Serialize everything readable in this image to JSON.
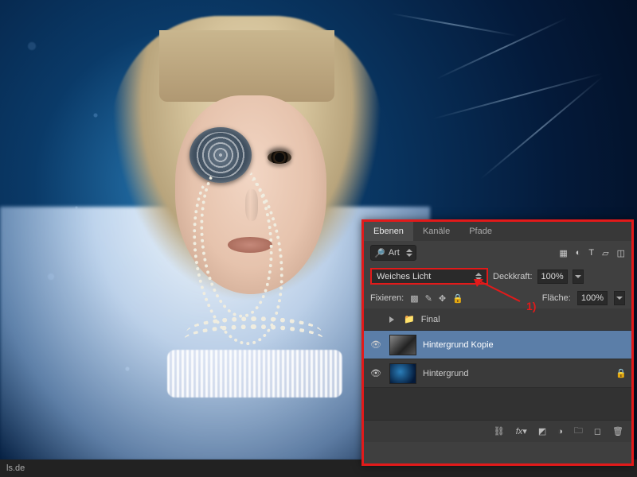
{
  "footer_text": "ls.de",
  "panel": {
    "tabs": [
      "Ebenen",
      "Kanäle",
      "Pfade"
    ],
    "active_tab": 0,
    "filter_label": "Art",
    "blend_mode": "Weiches Licht",
    "opacity_label": "Deckkraft:",
    "opacity_value": "100%",
    "lock_label": "Fixieren:",
    "fill_label": "Fläche:",
    "fill_value": "100%",
    "group": {
      "name": "Final"
    },
    "layers": [
      {
        "name": "Hintergrund Kopie",
        "visible": true,
        "selected": true,
        "locked": false,
        "thumb": "bw"
      },
      {
        "name": "Hintergrund",
        "visible": true,
        "selected": false,
        "locked": true,
        "thumb": "col"
      }
    ]
  },
  "annotation": {
    "label": "1)"
  }
}
